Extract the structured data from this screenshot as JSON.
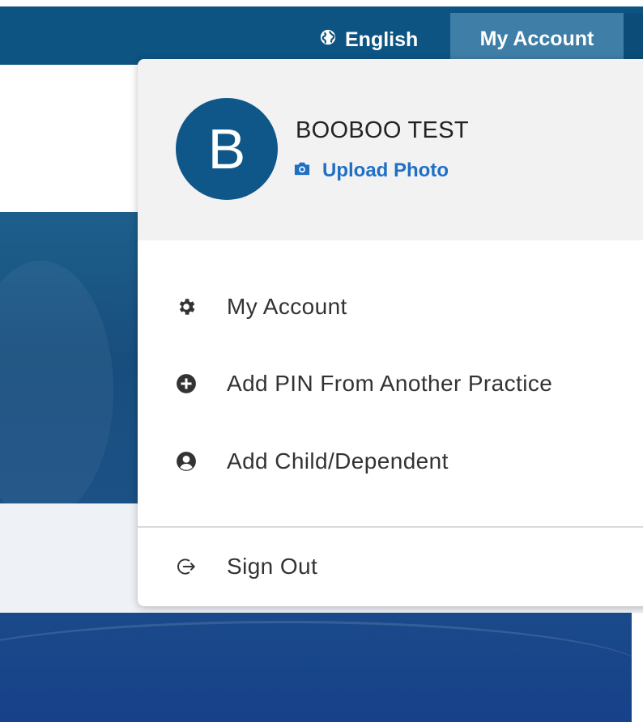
{
  "topbar": {
    "language_label": "English",
    "account_label": "My Account"
  },
  "dropdown": {
    "avatar_initial": "B",
    "user_name": "BOOBOO TEST",
    "upload_photo_label": "Upload Photo",
    "menu": [
      {
        "label": "My Account",
        "icon": "gear-icon"
      },
      {
        "label": "Add PIN From Another Practice",
        "icon": "plus-circle-icon"
      },
      {
        "label": "Add Child/Dependent",
        "icon": "user-circle-icon"
      }
    ],
    "sign_out_label": "Sign Out",
    "sign_out_icon": "sign-out-icon"
  },
  "colors": {
    "header_bg": "#0d5482",
    "account_button_bg": "#3f7ea6",
    "avatar_bg": "#0f5788",
    "link_blue": "#1f6fc4",
    "profile_bg": "#f2f2f2"
  }
}
